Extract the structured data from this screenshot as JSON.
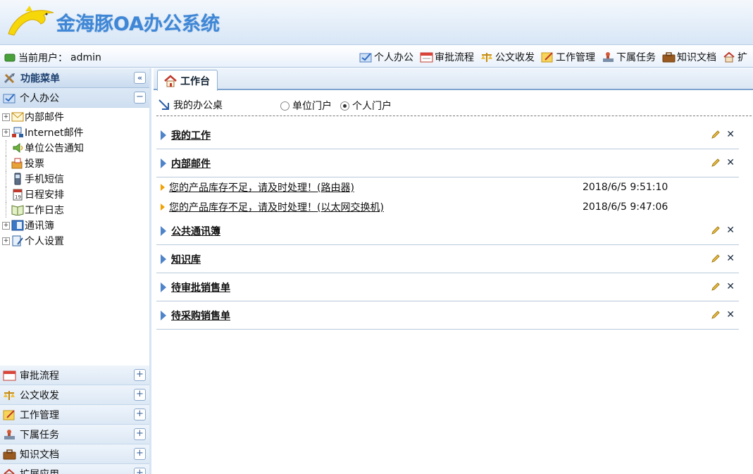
{
  "brand": {
    "title": "金海豚OA办公系统"
  },
  "user": {
    "label": "当前用户：",
    "name": "admin"
  },
  "top_nav": [
    {
      "label": "个人办公",
      "icon": "personal-office-icon"
    },
    {
      "label": "审批流程",
      "icon": "calendar-icon"
    },
    {
      "label": "公文收发",
      "icon": "scale-icon"
    },
    {
      "label": "工作管理",
      "icon": "edit-note-icon"
    },
    {
      "label": "下属任务",
      "icon": "stamp-icon"
    },
    {
      "label": "知识文档",
      "icon": "briefcase-icon"
    },
    {
      "label": "扩",
      "icon": "house-icon"
    }
  ],
  "sidebar": {
    "menu_title": "功能菜单",
    "active_section": "个人办公",
    "tree": [
      {
        "label": "内部邮件",
        "expandable": true,
        "icon": "envelope-icon"
      },
      {
        "label": "Internet邮件",
        "expandable": true,
        "icon": "network-icon"
      },
      {
        "label": "单位公告通知",
        "expandable": false,
        "icon": "speaker-icon"
      },
      {
        "label": "投票",
        "expandable": false,
        "icon": "ballot-icon"
      },
      {
        "label": "手机短信",
        "expandable": false,
        "icon": "phone-icon"
      },
      {
        "label": "日程安排",
        "expandable": false,
        "icon": "calendar-day-icon"
      },
      {
        "label": "工作日志",
        "expandable": false,
        "icon": "book-icon"
      },
      {
        "label": "通讯簿",
        "expandable": true,
        "icon": "address-book-icon"
      },
      {
        "label": "个人设置",
        "expandable": true,
        "icon": "settings-doc-icon"
      }
    ],
    "sections": [
      {
        "label": "审批流程",
        "icon": "calendar-icon"
      },
      {
        "label": "公文收发",
        "icon": "scale-icon"
      },
      {
        "label": "工作管理",
        "icon": "edit-note-icon"
      },
      {
        "label": "下属任务",
        "icon": "stamp-icon"
      },
      {
        "label": "知识文档",
        "icon": "briefcase-icon"
      },
      {
        "label": "扩展应用",
        "icon": "house-icon"
      }
    ]
  },
  "main": {
    "tab": "工作台",
    "desk_title": "我的办公桌",
    "radios": [
      {
        "label": "单位门户",
        "checked": false
      },
      {
        "label": "个人门户",
        "checked": true
      }
    ],
    "modules": [
      {
        "title": "我的工作",
        "items": []
      },
      {
        "title": "内部邮件",
        "items": [
          {
            "subject": "您的产品库存不足，请及时处理！(路由器)",
            "time": "2018/6/5 9:51:10"
          },
          {
            "subject": "您的产品库存不足，请及时处理！(以太网交换机)",
            "time": "2018/6/5 9:47:06"
          }
        ]
      },
      {
        "title": "公共通讯簿",
        "items": []
      },
      {
        "title": "知识库",
        "items": []
      },
      {
        "title": "待审批销售单",
        "items": []
      },
      {
        "title": "待采购销售单",
        "items": []
      }
    ]
  }
}
